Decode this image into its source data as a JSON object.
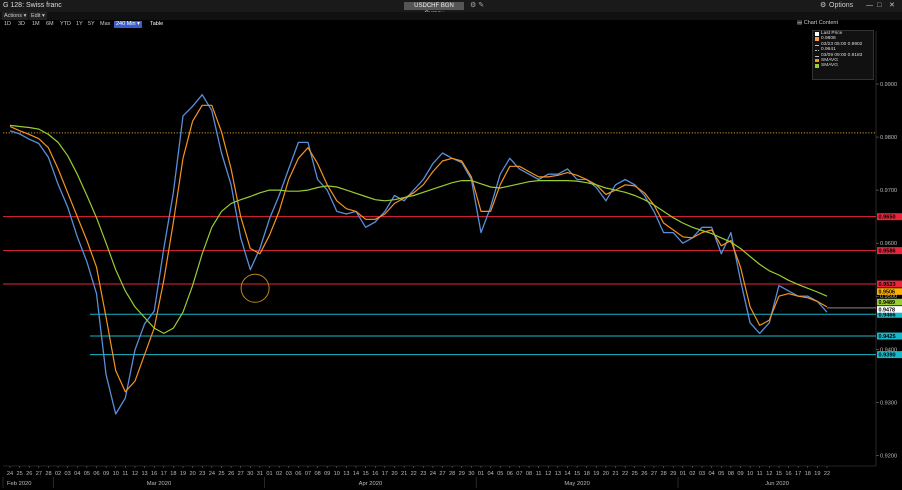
{
  "window": {
    "title": "G 128: Swiss franc",
    "ticker": "USDCHF BGN Curncy",
    "options_label": "Options"
  },
  "menu": [
    {
      "label": "Actions ▾"
    },
    {
      "label": "Edit ▾"
    }
  ],
  "timeframes": [
    {
      "label": "1D"
    },
    {
      "label": "3D"
    },
    {
      "label": "1M"
    },
    {
      "label": "6M"
    },
    {
      "label": "YTD"
    },
    {
      "label": "1Y"
    },
    {
      "label": "5Y"
    },
    {
      "label": "Max"
    },
    {
      "label": "240 Min ▾",
      "selected": true
    },
    {
      "label": "Table"
    }
  ],
  "chart_content_label": "Chart Content",
  "legend": [
    {
      "label": "Last Price",
      "color": "#ffffff"
    },
    {
      "label": "0.9808",
      "color": "#f7a44a"
    },
    {
      "label": "03/23 05:00  0.9902",
      "color": ""
    },
    {
      "label": "0.9641",
      "color": ""
    },
    {
      "label": "03/09 09:00  0.9183",
      "color": ""
    },
    {
      "label": "SMAVG",
      "color": "#f7931e"
    },
    {
      "label": "SMAVG",
      "color": "#9acd32"
    }
  ],
  "colors": {
    "price": "#5a8ed8",
    "sma_fast": "#f7931e",
    "sma_slow": "#9acd32",
    "resistance": "#e8253a",
    "support": "#17b8c9",
    "dotted": "#c99a2e",
    "highlight_circle": "#b8861c"
  },
  "chart_data": {
    "type": "line",
    "ylim": [
      0.918,
      1.0
    ],
    "y_ticks": [
      {
        "value": 0.99,
        "label": "0.9900"
      },
      {
        "value": 0.98,
        "label": "0.9800"
      },
      {
        "value": 0.97,
        "label": "0.9700"
      },
      {
        "value": 0.96,
        "label": "0.9600"
      },
      {
        "value": 0.95,
        "label": "0.9500"
      },
      {
        "value": 0.94,
        "label": "0.9400"
      },
      {
        "value": 0.93,
        "label": "0.9300"
      },
      {
        "value": 0.92,
        "label": "0.9200"
      }
    ],
    "x_ticks": [
      "24",
      "25",
      "26",
      "27",
      "28",
      "02",
      "03",
      "04",
      "05",
      "06",
      "09",
      "10",
      "11",
      "12",
      "13",
      "16",
      "17",
      "18",
      "19",
      "20",
      "23",
      "24",
      "25",
      "26",
      "27",
      "30",
      "31",
      "01",
      "02",
      "03",
      "06",
      "07",
      "08",
      "09",
      "10",
      "13",
      "14",
      "15",
      "16",
      "17",
      "20",
      "21",
      "22",
      "23",
      "24",
      "27",
      "28",
      "29",
      "30",
      "01",
      "04",
      "05",
      "06",
      "07",
      "08",
      "11",
      "12",
      "13",
      "14",
      "15",
      "18",
      "19",
      "20",
      "21",
      "22",
      "25",
      "26",
      "27",
      "28",
      "29",
      "01",
      "02",
      "03",
      "04",
      "05",
      "08",
      "09",
      "10",
      "11",
      "12",
      "15",
      "16",
      "17",
      "18",
      "19",
      "22"
    ],
    "months": [
      {
        "label": "Feb 2020",
        "start": 0,
        "end": 5
      },
      {
        "label": "Mar 2020",
        "start": 5,
        "end": 27
      },
      {
        "label": "Apr 2020",
        "start": 27,
        "end": 49
      },
      {
        "label": "May 2020",
        "start": 49,
        "end": 70
      },
      {
        "label": "Jun 2020",
        "start": 70,
        "end": 86
      }
    ],
    "series": [
      {
        "values": [
          0.9812,
          0.9806,
          0.9796,
          0.9788,
          0.9762,
          0.9711,
          0.9668,
          0.9612,
          0.9565,
          0.9505,
          0.9352,
          0.9278,
          0.9308,
          0.9399,
          0.9448,
          0.9472,
          0.959,
          0.9696,
          0.984,
          0.9858,
          0.988,
          0.985,
          0.977,
          0.971,
          0.961,
          0.955,
          0.959,
          0.9646,
          0.969,
          0.974,
          0.979,
          0.979,
          0.972,
          0.97,
          0.966,
          0.9655,
          0.966,
          0.963,
          0.964,
          0.966,
          0.969,
          0.968,
          0.97,
          0.972,
          0.975,
          0.977,
          0.976,
          0.9752,
          0.972,
          0.962,
          0.9668,
          0.973,
          0.976,
          0.974,
          0.973,
          0.972,
          0.973,
          0.973,
          0.974,
          0.972,
          0.972,
          0.9705,
          0.968,
          0.971,
          0.972,
          0.971,
          0.969,
          0.966,
          0.962,
          0.962,
          0.96,
          0.961,
          0.963,
          0.963,
          0.958,
          0.962,
          0.953,
          0.945,
          0.943,
          0.945,
          0.952,
          0.951,
          0.95,
          0.95,
          0.949,
          0.947
        ]
      },
      {
        "values": [
          0.982,
          0.9812,
          0.9805,
          0.9797,
          0.978,
          0.974,
          0.9695,
          0.965,
          0.9605,
          0.9555,
          0.946,
          0.936,
          0.932,
          0.934,
          0.939,
          0.944,
          0.953,
          0.964,
          0.976,
          0.983,
          0.986,
          0.986,
          0.981,
          0.974,
          0.965,
          0.959,
          0.958,
          0.9615,
          0.966,
          0.972,
          0.976,
          0.978,
          0.975,
          0.971,
          0.968,
          0.9665,
          0.966,
          0.9645,
          0.9645,
          0.9655,
          0.9675,
          0.9685,
          0.9695,
          0.971,
          0.9735,
          0.9755,
          0.976,
          0.9755,
          0.9725,
          0.966,
          0.966,
          0.971,
          0.9745,
          0.9745,
          0.9735,
          0.9725,
          0.9725,
          0.9728,
          0.9733,
          0.9728,
          0.972,
          0.971,
          0.9692,
          0.97,
          0.971,
          0.9708,
          0.9695,
          0.9672,
          0.9638,
          0.9625,
          0.9612,
          0.961,
          0.962,
          0.9625,
          0.9595,
          0.9605,
          0.9555,
          0.948,
          0.9445,
          0.9455,
          0.95,
          0.9505,
          0.95,
          0.9497,
          0.949,
          0.948
        ]
      },
      {
        "values": [
          0.9822,
          0.982,
          0.9818,
          0.9815,
          0.9805,
          0.979,
          0.9765,
          0.973,
          0.969,
          0.9648,
          0.96,
          0.955,
          0.951,
          0.948,
          0.946,
          0.944,
          0.943,
          0.944,
          0.947,
          0.952,
          0.958,
          0.963,
          0.966,
          0.9675,
          0.9682,
          0.9688,
          0.9695,
          0.97,
          0.97,
          0.9698,
          0.9698,
          0.97,
          0.9705,
          0.9708,
          0.9706,
          0.97,
          0.9694,
          0.9688,
          0.9682,
          0.968,
          0.9682,
          0.9686,
          0.969,
          0.9696,
          0.9702,
          0.9708,
          0.9714,
          0.9718,
          0.9718,
          0.9712,
          0.9706,
          0.9704,
          0.9708,
          0.9712,
          0.9716,
          0.9718,
          0.9718,
          0.9718,
          0.9718,
          0.9717,
          0.9714,
          0.971,
          0.9704,
          0.97,
          0.9696,
          0.969,
          0.9682,
          0.9672,
          0.966,
          0.9648,
          0.9638,
          0.963,
          0.9624,
          0.9618,
          0.961,
          0.9602,
          0.959,
          0.9575,
          0.956,
          0.9548,
          0.954,
          0.953,
          0.9522,
          0.9515,
          0.9508,
          0.95
        ]
      }
    ],
    "levels": [
      {
        "value": 0.9808,
        "style": "dotted"
      },
      {
        "value": 0.965,
        "label": "0.9650",
        "style": "resistance"
      },
      {
        "value": 0.9586,
        "label": "0.9586",
        "style": "resistance"
      },
      {
        "value": 0.9523,
        "label": "0.9523",
        "style": "resistance"
      },
      {
        "value": 0.9466,
        "label": "0.9466",
        "style": "support"
      },
      {
        "value": 0.9425,
        "label": "0.9425",
        "style": "support"
      },
      {
        "value": 0.939,
        "label": "0.9390",
        "style": "support"
      }
    ],
    "right_labels": [
      {
        "value": 0.9506,
        "label": "0.9506",
        "color": "#ffb000"
      },
      {
        "value": 0.9489,
        "label": "0.9489",
        "color": "#9acd32"
      },
      {
        "value": 0.9478,
        "label": "0.9478",
        "color": "#ffffff"
      }
    ],
    "annotation_circle": {
      "x_index": 25.5,
      "y": 0.9515
    }
  }
}
